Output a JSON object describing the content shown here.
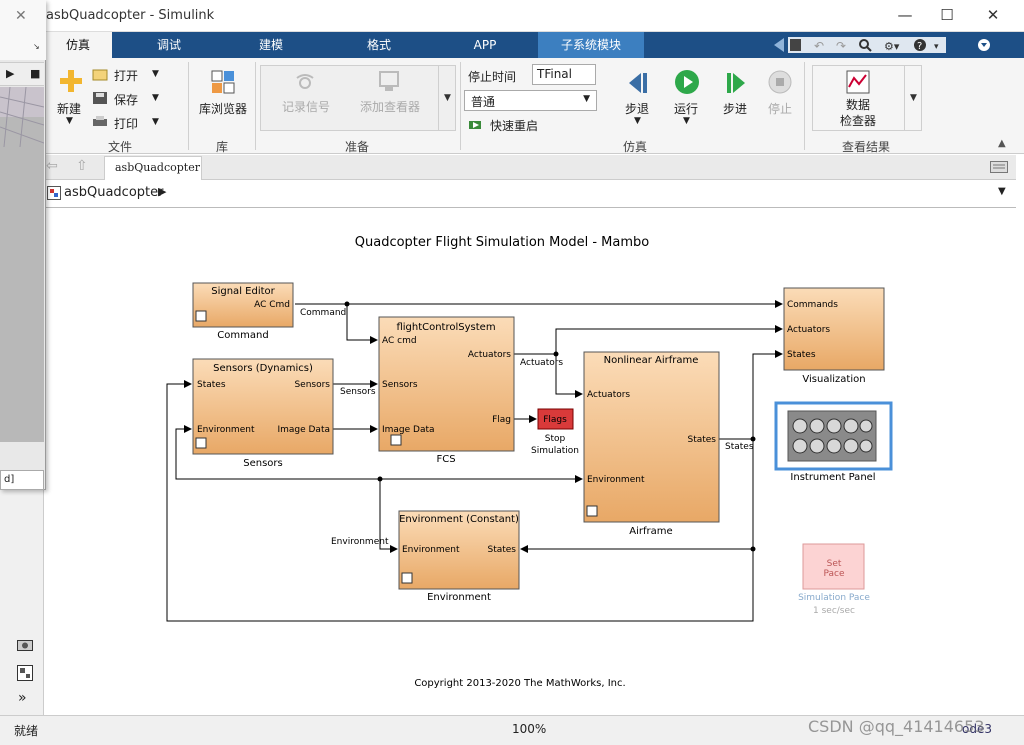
{
  "window": {
    "title": "asbQuadcopter - Simulink",
    "minimize": "—",
    "maximize": "☐",
    "close": "✕"
  },
  "ribbon_tabs": [
    {
      "label": "仿真",
      "active": true
    },
    {
      "label": "调试"
    },
    {
      "label": "建模"
    },
    {
      "label": "格式"
    },
    {
      "label": "APP"
    },
    {
      "label": "子系统模块"
    }
  ],
  "file_group": {
    "new_label": "新建",
    "open_label": "打开",
    "save_label": "保存",
    "print_label": "打印",
    "group_label": "文件"
  },
  "library_group": {
    "browser_label": "库浏览器",
    "group_label": "库"
  },
  "prepare_group": {
    "record_label": "记录信号",
    "add_viewer_label": "添加查看器",
    "group_label": "准备"
  },
  "simulate_group": {
    "stop_time_label": "停止时间",
    "stop_time_value": "TFinal",
    "mode_value": "普通",
    "fast_restart_label": "快速重启",
    "step_back_label": "步退",
    "run_label": "运行",
    "step_forward_label": "步进",
    "stop_label": "停止",
    "group_label": "仿真"
  },
  "results_group": {
    "inspector_line1": "数据",
    "inspector_line2": "检查器",
    "group_label": "查看结果"
  },
  "model_tab": "asbQuadcopter",
  "breadcrumb": "asbQuadcopter",
  "diagram": {
    "title": "Quadcopter Flight Simulation Model - Mambo",
    "copyright": "Copyright 2013-2020 The MathWorks, Inc.",
    "blocks": {
      "signal_editor": {
        "title": "Signal Editor",
        "port_out": "AC Cmd",
        "name": "Command"
      },
      "sensors": {
        "title": "Sensors (Dynamics)",
        "port_in1": "States",
        "port_in2": "Environment",
        "port_out1": "Sensors",
        "port_out2": "Image Data",
        "name": "Sensors"
      },
      "fcs": {
        "title": "flightControlSystem",
        "port_in1": "AC cmd",
        "port_in2": "Sensors",
        "port_in3": "Image Data",
        "port_out1": "Actuators",
        "port_out2": "Flag",
        "name": "FCS"
      },
      "flags": {
        "title": "Flags",
        "name1": "Stop",
        "name2": "Simulation"
      },
      "airframe": {
        "title": "Nonlinear Airframe",
        "port_in1": "Actuators",
        "port_in2": "Environment",
        "port_out": "States",
        "name": "Airframe"
      },
      "environment": {
        "title": "Environment (Constant)",
        "port_in": "Environment",
        "port_out": "States",
        "name": "Environment"
      },
      "visualization": {
        "port_in1": "Commands",
        "port_in2": "Actuators",
        "port_in3": "States",
        "name": "Visualization"
      },
      "instrument_panel": {
        "name": "Instrument Panel"
      },
      "set_pace": {
        "line1": "Set",
        "line2": "Pace",
        "name": "Simulation Pace",
        "rate": "1 sec/sec"
      }
    },
    "signals": {
      "command": "Command",
      "sensors": "Sensors",
      "actuators": "Actuators",
      "states": "States",
      "environment": "Environment"
    }
  },
  "status": {
    "left": "就绪",
    "zoom": "100%",
    "solver": "ode3"
  },
  "watermark": "CSDN @qq_41414653",
  "colors": {
    "tab_bar": "#1d4f86",
    "subsystem_tab": "#3c7fc0",
    "block_fill": "#f2c394",
    "flags_fill": "#d93a3a",
    "run_green": "#2ea84a"
  }
}
